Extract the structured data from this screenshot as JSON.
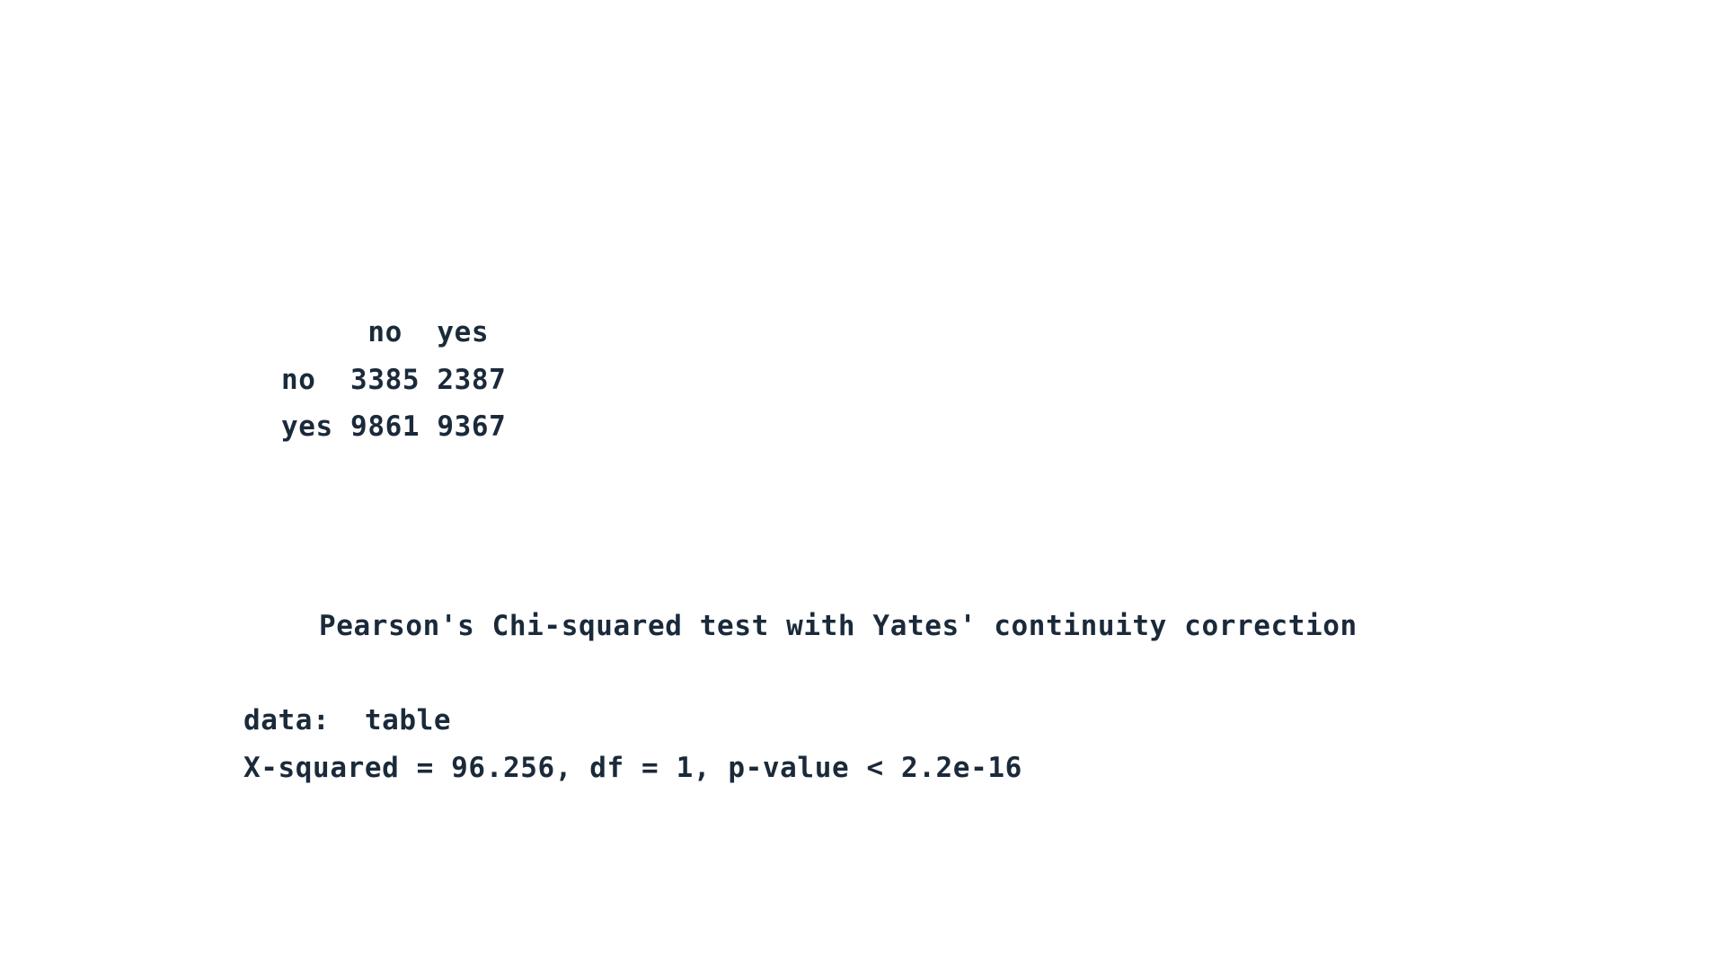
{
  "contingency_table": {
    "header_line": "     no  yes",
    "rows": [
      "no  3385 2387",
      "yes 9861 9367"
    ]
  },
  "test_result": {
    "title": "Pearson's Chi-squared test with Yates' continuity correction",
    "data_line": "data:  table",
    "statistics_line": "X-squared = 96.256, df = 1, p-value < 2.2e-16"
  }
}
